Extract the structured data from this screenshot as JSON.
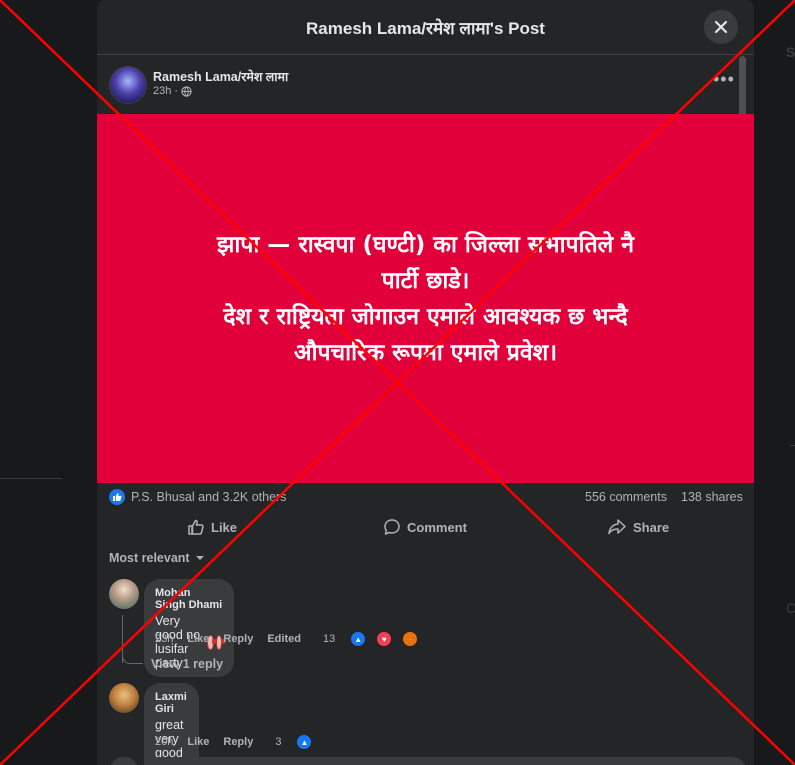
{
  "modal": {
    "title": "Ramesh Lama/रमेश लामा's Post"
  },
  "post": {
    "author": "Ramesh Lama/रमेश लामा",
    "time": "23h",
    "image_text": "झापा — रास्वपा (घण्टी) का जिल्ला सभापतिले नै\nपार्टी छाडे।\nदेश र राष्ट्रियता जोगाउन एमाले आवश्यक छ भन्दै\nऔपचारिक रूपमा एमाले प्रवेश।",
    "image_bg": "#e2003a"
  },
  "stats": {
    "reactors": "P.S. Bhusal and 3.2K others",
    "comments": "556 comments",
    "shares": "138 shares"
  },
  "actions": {
    "like": "Like",
    "comment": "Comment",
    "share": "Share"
  },
  "sort_label": "Most relevant",
  "comments": [
    {
      "name": "Mohan Singh Dhami",
      "text": "Very good no lusifar party",
      "time": "23h",
      "like": "Like",
      "reply": "Reply",
      "edited": "Edited",
      "reactions": "13",
      "view_replies": "View 1 reply"
    },
    {
      "name": "Laxmi Giri",
      "text": "great very good news",
      "time": "20h",
      "like": "Like",
      "reply": "Reply",
      "reactions": "3"
    }
  ],
  "colors": {
    "like_blue": "#1877f2",
    "overlay_red": "#ff0000"
  }
}
